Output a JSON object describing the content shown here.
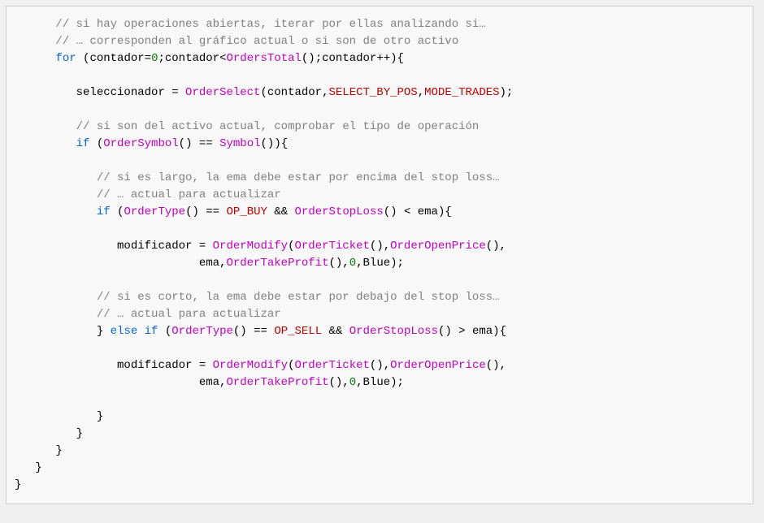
{
  "code": {
    "indent": {
      "i3": "      ",
      "i4": "         ",
      "i5": "            ",
      "i6": "               ",
      "i7": "                           "
    },
    "comment1": "// si hay operaciones abiertas, iterar por ellas analizando si…",
    "comment2": "// … corresponden al gráfico actual o si son de otro activo",
    "for_kw": "for",
    "for_open": " (contador=",
    "zero": "0",
    "for_mid": ";contador<",
    "orders_total": "OrdersTotal",
    "for_close": "();contador++){",
    "sel_assign": "seleccionador = ",
    "order_select": "OrderSelect",
    "sel_args_open": "(contador,",
    "select_by_pos": "SELECT_BY_POS",
    "comma": ",",
    "mode_trades": "MODE_TRADES",
    "sel_close": ");",
    "comment3": "// si son del activo actual, comprobar el tipo de operación",
    "if_kw": "if",
    "if1_open": " (",
    "order_symbol": "OrderSymbol",
    "if1_mid": "() == ",
    "symbol": "Symbol",
    "if1_close": "()){",
    "comment4": "// si es largo, la ema debe estar por encima del stop loss…",
    "comment5": "// … actual para actualizar",
    "if2_open": " (",
    "order_type": "OrderType",
    "if2_mid1": "() == ",
    "op_buy": "OP_BUY",
    "if2_mid2": " && ",
    "order_stoploss": "OrderStopLoss",
    "if2_close_lt": "() < ema){",
    "mod_assign": "modificador = ",
    "order_modify": "OrderModify",
    "mod_args_open": "(",
    "order_ticket": "OrderTicket",
    "mod_mid1": "(),",
    "order_openprice": "OrderOpenPrice",
    "mod_mid2": "(),",
    "mod_line2_pre": "ema,",
    "order_takeprofit": "OrderTakeProfit",
    "mod_line2_mid": "(),",
    "mod_line2_end": ",Blue);",
    "comment6": "// si es corto, la ema debe estar por debajo del stop loss…",
    "comment7": "// … actual para actualizar",
    "else_brace": "} ",
    "else_kw": "else",
    "space": " ",
    "if3_close_gt": "() > ema){",
    "op_sell": "OP_SELL",
    "close_brace": "}",
    "i2": "   ",
    "i1": ""
  }
}
